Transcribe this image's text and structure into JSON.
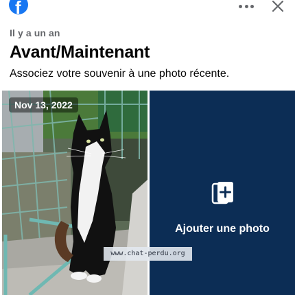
{
  "header": {
    "logo_icon": "facebook-logo-icon",
    "logo_letter": "f",
    "more_icon": "more-horizontal-icon",
    "close_icon": "close-icon",
    "brand_color": "#1877f2"
  },
  "memory": {
    "eyebrow": "Il y a un an",
    "title": "Avant/Maintenant",
    "subtitle": "Associez votre souvenir à une photo récente."
  },
  "photo": {
    "date": "Nov 13, 2022",
    "subject": "black-and-white cat"
  },
  "add_photo": {
    "icon": "add-photo-icon",
    "label": "Ajouter une photo",
    "panel_color": "#0c2d55"
  },
  "watermark": {
    "text": "www.chat-perdu.org"
  }
}
